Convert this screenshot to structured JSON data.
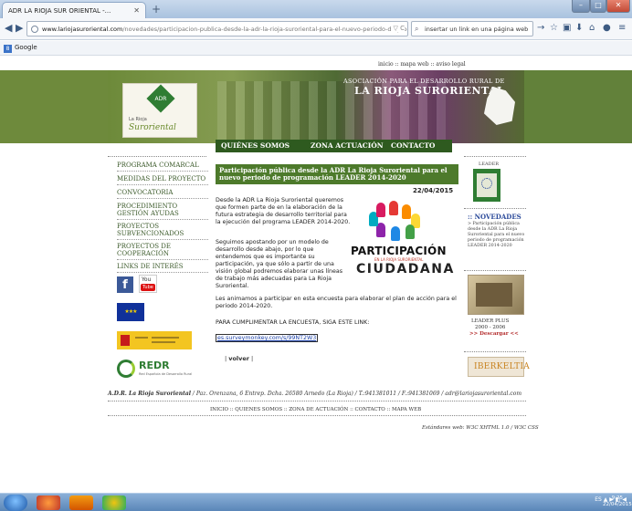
{
  "browser": {
    "tab_title": "ADR LA RIOJA SUR ORIENTAL -...",
    "url_domain": "www.lariojasuroriental.com",
    "url_path": "/novedades/participacion-publica-desde-la-adr-la-rioja-suroriental-para-el-nuevo-periodo-de-progra",
    "search_placeholder": "insertar un link en una página web",
    "bookmark": "Google"
  },
  "site": {
    "top_links": "inicio :: mapa web :: aviso legal",
    "banner_subtitle": "ASOCIACIÓN PARA EL DESARROLLO RURAL DE",
    "banner_title": "LA RIOJA SURORIENTAL",
    "logo_adr": "ADR",
    "logo_rioja": "La Rioja",
    "logo_suroriental": "Suroriental",
    "nav": [
      "QUIÉNES SOMOS",
      "ZONA ACTUACIÓN",
      "CONTACTO"
    ],
    "sidebar": [
      "PROGRAMA COMARCAL",
      "MEDIDAS DEL PROYECTO",
      "CONVOCATORIA",
      "PROCEDIMIENTO GESTIÓN AYUDAS",
      "PROYECTOS SUBVENCIONADOS",
      "PROYECTOS DE COOPERACIÓN",
      "LINKS DE INTERÉS"
    ],
    "youtube": {
      "you": "You",
      "tube": "Tube"
    },
    "redr": {
      "name": "REDR",
      "sub": "Red Española de Desarrollo Rural"
    }
  },
  "article": {
    "title": "Participación pública desde la ADR La Rioja Suroriental para el nuevo periodo de programación LEADER 2014-2020",
    "date": "22/04/2015",
    "para1": "Desde la ADR La Rioja Suroriental queremos que formen parte de en la elaboración de la futura estrategia de desarrollo territorial para la ejecución del programa LEADER 2014-2020.",
    "para2": "Seguimos apostando por un modelo de desarrollo desde abajo, por lo que entendemos que es importante su participación, ya que sólo a partir de una visión global podremos elaborar unas líneas de trabajo más adecuadas para La Rioja Suroriental.",
    "para3": "Les animamos a participar en esta encuesta para elaborar el plan de acción para el periodo 2014-2020.",
    "para4": "PARA CUMPLIMENTAR LA ENCUESTA, SIGA ESTE LINK:",
    "survey_link": "es.surveymonkey.com/s/99NT2W3",
    "back": "volver",
    "image": {
      "word1": "PARTICIPACIÓN",
      "sub": "EN LA RIOJA SURORIENTAL",
      "word2": "CIUDADANA"
    }
  },
  "right": {
    "leader_label": "LEADER",
    "novedades_title": ":: NOVEDADES",
    "novedades_text": "> Participación pública desde la ADR La Rioja Suroriental para el nuevo periodo de programación LEADER 2014-2020",
    "leaderplus_title": "LEADER PLUS",
    "leaderplus_years": "2000 - 2006",
    "descargar": ">> Descargar <<",
    "iberkeltia": "IBERKELTIA"
  },
  "footer": {
    "address_name": "A.D.R. La Rioja Suroriental",
    "address": " / Paz. Orenzana, 6 Entrep. Dcha. 26580 Arnedo (La Rioja) / T.:941381011 / F.:941381069 / adr@lariojasuroriental.com",
    "links": "INICIO :: QUIENES SOMOS :: ZONA DE ACTUACIÓN :: CONTACTO :: MAPA WEB",
    "standards": "Estándares web: W3C XHTML 1.0 / W3C CSS"
  },
  "taskbar": {
    "lang": "ES",
    "time": "9:25",
    "date": "22/04/2015"
  },
  "colors": {
    "site_green": "#2e5a1f",
    "header_green": "#4d7a2b",
    "link_blue": "#1a3fa8"
  }
}
